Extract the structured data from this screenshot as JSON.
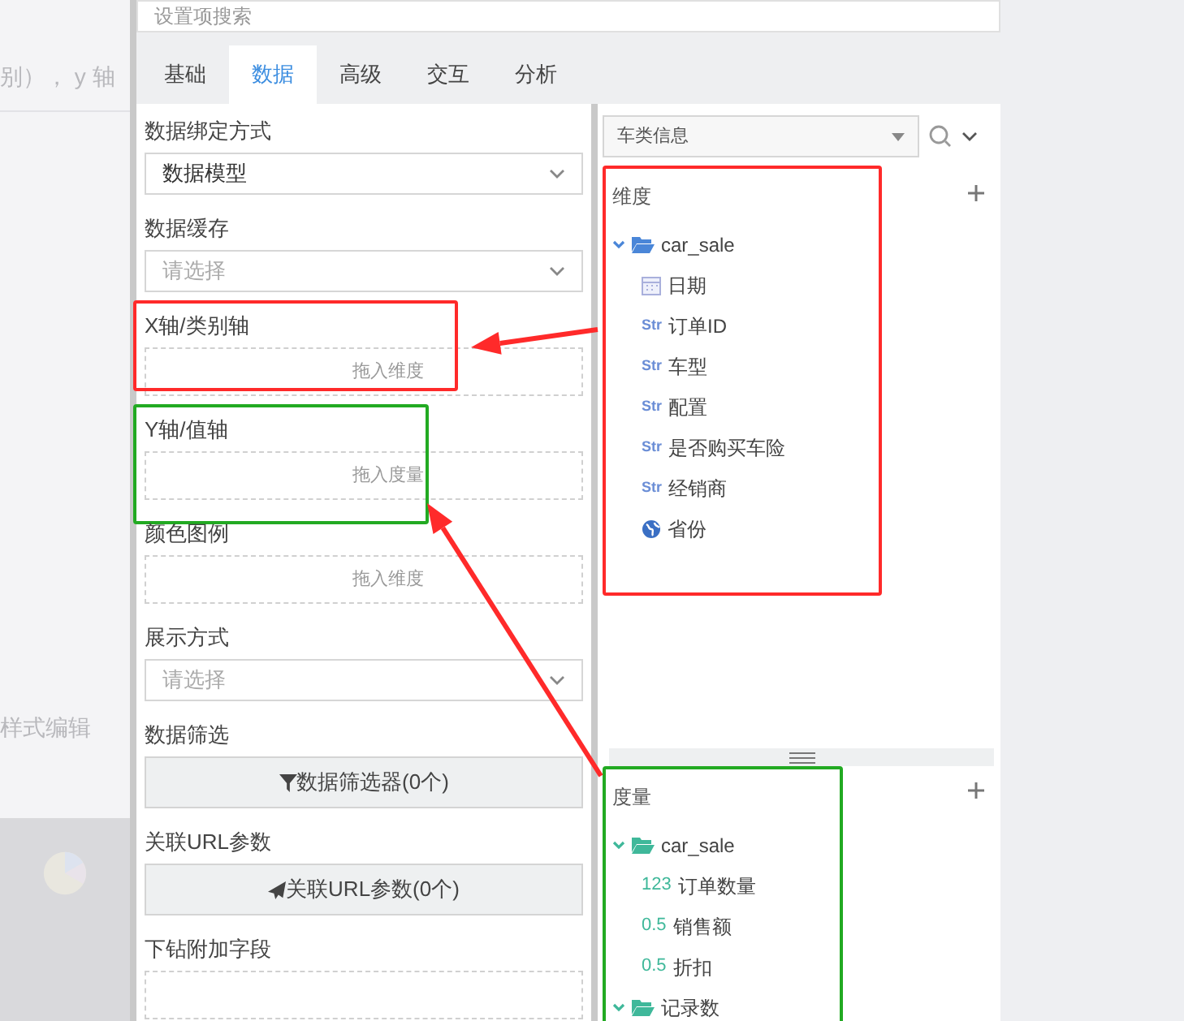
{
  "background": {
    "texts": [
      "别）， y 轴",
      "样式编辑"
    ]
  },
  "search": {
    "placeholder": "设置项搜索"
  },
  "tabs": [
    {
      "label": "基础",
      "selected": false
    },
    {
      "label": "数据",
      "selected": true
    },
    {
      "label": "高级",
      "selected": false
    },
    {
      "label": "交互",
      "selected": false
    },
    {
      "label": "分析",
      "selected": false
    }
  ],
  "settings": [
    {
      "kind": "select",
      "label": "数据绑定方式",
      "value": "数据模型"
    },
    {
      "kind": "select",
      "label": "数据缓存",
      "placeholder": "请选择"
    },
    {
      "kind": "dropzone",
      "label": "X轴/类别轴",
      "hint": "拖入维度",
      "color": "#ff2a2a"
    },
    {
      "kind": "dropzone",
      "label": "Y轴/值轴",
      "hint": "拖入度量",
      "color": "#22aa22"
    },
    {
      "kind": "dropzone",
      "label": "颜色图例",
      "hint": "拖入维度"
    },
    {
      "kind": "select",
      "label": "展示方式",
      "placeholder": "请选择"
    },
    {
      "kind": "filter_button",
      "label": "数据筛选",
      "button": "数据筛选器(0个)"
    },
    {
      "kind": "link_button",
      "label": "关联URL参数",
      "button": "关联URL参数(0个)"
    },
    {
      "kind": "dropzone",
      "label": "下钻附加字段"
    }
  ],
  "dataset_select": {
    "value": "车类信息"
  },
  "dimensions": {
    "title": "维度",
    "color": "#ff2a2a",
    "folders": [
      {
        "label": "car_sale",
        "expanded": true,
        "children": [
          {
            "kind": "date",
            "label": "日期"
          },
          {
            "kind": "string",
            "badge": "Str",
            "label": "订单ID"
          },
          {
            "kind": "string",
            "badge": "Str",
            "label": "车型"
          },
          {
            "kind": "string",
            "badge": "Str",
            "label": "配置"
          },
          {
            "kind": "string",
            "badge": "Str",
            "label": "是否购买车险"
          },
          {
            "kind": "string",
            "badge": "Str",
            "label": "经销商"
          },
          {
            "kind": "geo",
            "label": "省份"
          }
        ]
      }
    ]
  },
  "measures": {
    "title": "度量",
    "color": "#22aa22",
    "folders": [
      {
        "label": "car_sale",
        "expanded": true,
        "children": [
          {
            "kind": "number",
            "badge": "123",
            "label": "订单数量"
          },
          {
            "kind": "number",
            "badge": "0.5",
            "label": "销售额"
          },
          {
            "kind": "number",
            "badge": "0.5",
            "label": "折扣"
          }
        ]
      },
      {
        "label": "记录数",
        "expanded": true
      }
    ]
  },
  "arrows": [
    {
      "color": "#ff2a2a"
    },
    {
      "color": "#ff2a2a"
    }
  ]
}
